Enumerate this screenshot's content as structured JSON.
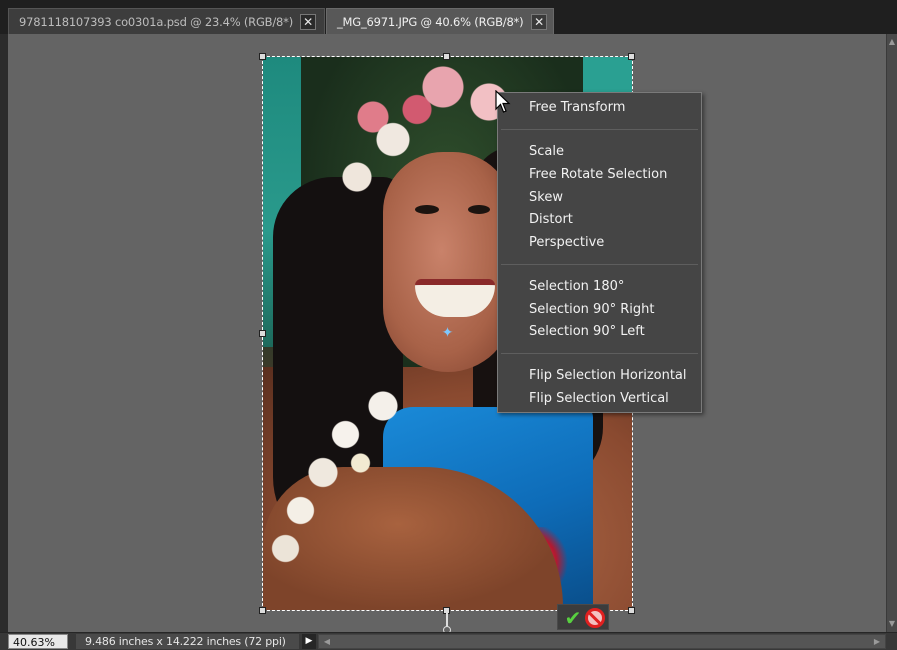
{
  "tabs": [
    {
      "label": "9781118107393 co0301a.psd @ 23.4% (RGB/8*)",
      "close": "✕",
      "active": false
    },
    {
      "label": "_MG_6971.JPG @ 40.6% (RGB/8*)",
      "close": "✕",
      "active": true
    }
  ],
  "context_menu": {
    "items": [
      {
        "label": "Free Transform"
      },
      {
        "label": "Scale"
      },
      {
        "label": "Free Rotate Selection"
      },
      {
        "label": "Skew"
      },
      {
        "label": "Distort"
      },
      {
        "label": "Perspective"
      },
      {
        "label": "Selection 180°"
      },
      {
        "label": "Selection 90° Right"
      },
      {
        "label": "Selection 90° Left"
      },
      {
        "label": "Flip Selection Horizontal"
      },
      {
        "label": "Flip Selection Vertical"
      }
    ]
  },
  "transform_controls": {
    "commit_icon": "checkmark-icon",
    "cancel_icon": "cancel-icon",
    "commit_symbol": "✔"
  },
  "status_bar": {
    "zoom": "40.63%",
    "doc_info": "9.486 inches x 14.222 inches (72 ppi)",
    "arrow": "▶"
  },
  "scrollbars": {
    "up": "▲",
    "down": "▼",
    "left": "◀",
    "right": "▶"
  },
  "colors": {
    "app_bg": "#2b2b2b",
    "canvas_bg": "#646464",
    "menu_bg": "#454545",
    "commit_green": "#58d040",
    "cancel_red": "#e02020"
  }
}
